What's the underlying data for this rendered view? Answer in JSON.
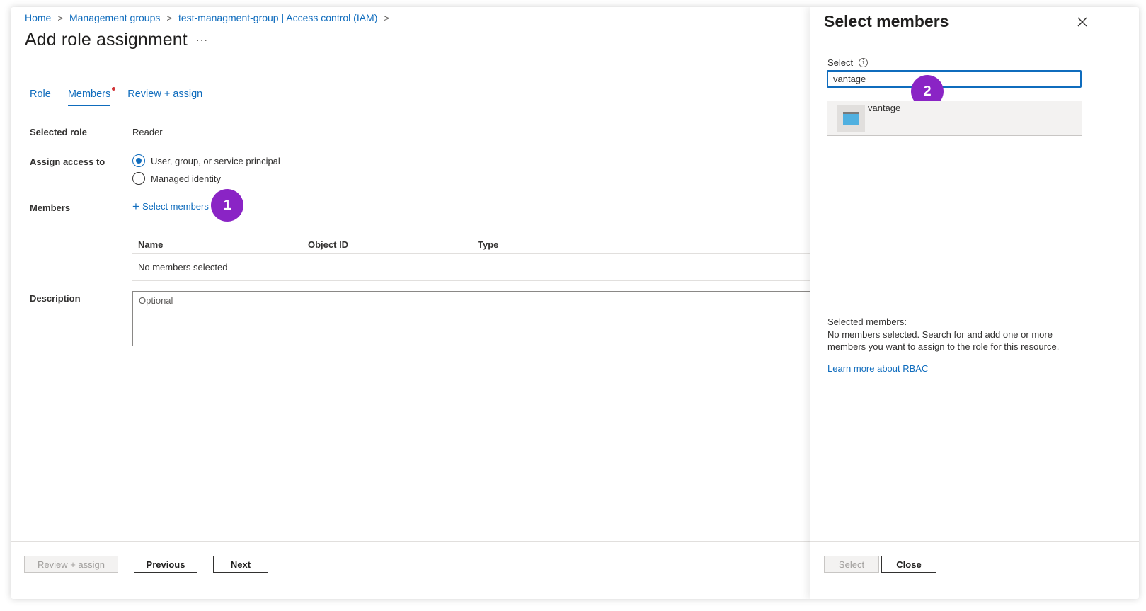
{
  "breadcrumb": {
    "items": [
      "Home",
      "Management groups",
      "test-managment-group | Access control (IAM)"
    ],
    "separator": ">"
  },
  "page": {
    "title": "Add role assignment",
    "more": "···"
  },
  "tabs": [
    {
      "label": "Role"
    },
    {
      "label": "Members",
      "active": true
    },
    {
      "label": "Review + assign"
    }
  ],
  "form": {
    "selected_role_label": "Selected role",
    "selected_role_value": "Reader",
    "assign_access_label": "Assign access to",
    "assign_options": [
      "User, group, or service principal",
      "Managed identity"
    ],
    "assign_selected_index": 0,
    "members_label": "Members",
    "select_members_link": "Select members",
    "description_label": "Description",
    "description_placeholder": "Optional"
  },
  "members_table": {
    "columns": [
      "Name",
      "Object ID",
      "Type"
    ],
    "empty_text": "No members selected"
  },
  "footer": {
    "review_assign": "Review + assign",
    "previous": "Previous",
    "next": "Next"
  },
  "annotations": {
    "step1": "1",
    "step2": "2",
    "color": "#8a24c5"
  },
  "panel": {
    "title": "Select members",
    "select_label": "Select",
    "search_value": "vantage",
    "results": [
      {
        "name": "vantage",
        "icon": "app-registration-icon"
      }
    ],
    "selected_members_title": "Selected members:",
    "selected_members_desc": "No members selected. Search for and add one or more members you want to assign to the role for this resource.",
    "learn_more": "Learn more about RBAC",
    "select_button": "Select",
    "close_button": "Close"
  },
  "colors": {
    "accent": "#0f6cbd",
    "required_dot": "#d13438"
  }
}
